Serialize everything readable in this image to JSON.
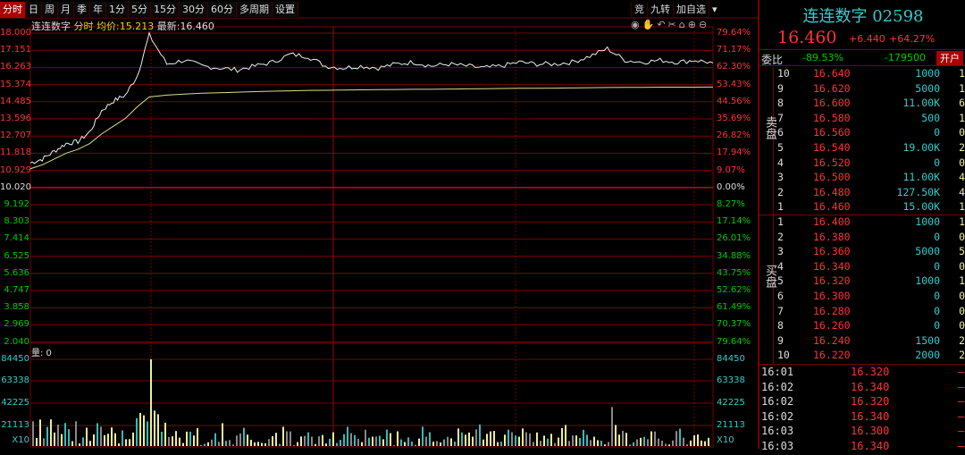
{
  "tabs": [
    "分时",
    "日",
    "周",
    "月",
    "季",
    "年",
    "1分",
    "5分",
    "15分",
    "30分",
    "60分",
    "多周期",
    "设置"
  ],
  "tools": [
    "竞",
    "九转",
    "加自选",
    "▾"
  ],
  "info": {
    "name": "连连数字",
    "mode": "分时",
    "avg_label": "均价:",
    "avg": "15.213",
    "last_label": "最新:",
    "last": "16.460"
  },
  "toolbar_icons": [
    "eye-icon",
    "hand-icon",
    "undo-icon",
    "scissors-icon",
    "lock-icon",
    "zoom-in-icon",
    "zoom-out-icon"
  ],
  "left_axis": [
    "18.000",
    "17.151",
    "16.263",
    "15.374",
    "14.485",
    "13.596",
    "12.707",
    "11.818",
    "10.929",
    "10.020",
    "9.192",
    "8.303",
    "7.414",
    "6.525",
    "5.636",
    "4.747",
    "3.858",
    "2.969",
    "2.040"
  ],
  "right_axis": [
    "79.64%",
    "71.17%",
    "62.30%",
    "53.43%",
    "44.56%",
    "35.69%",
    "26.82%",
    "17.94%",
    "9.07%",
    "0.00%",
    "8.27%",
    "17.14%",
    "26.01%",
    "34.88%",
    "43.75%",
    "52.62%",
    "61.49%",
    "70.37%",
    "79.64%"
  ],
  "volume_label": "量: 0",
  "volume_axis": [
    "84450",
    "63338",
    "42225",
    "21113",
    "X10"
  ],
  "chart_data": {
    "type": "line",
    "price": [
      11.3,
      11.5,
      11.9,
      12.3,
      12.4,
      12.9,
      14.0,
      14.5,
      14.8,
      15.8,
      17.9,
      16.4,
      16.6,
      16.3,
      16.2,
      16.1,
      16.3,
      16.5,
      16.9,
      16.8,
      16.3,
      16.2,
      16.3,
      16.2,
      16.4,
      16.5,
      16.3,
      16.4,
      16.3,
      16.2,
      16.3,
      16.5,
      16.4,
      16.4,
      16.5,
      16.8,
      17.2,
      16.6,
      16.5,
      16.6,
      16.5,
      16.6,
      16.46
    ],
    "avg": [
      11.0,
      11.2,
      11.5,
      11.8,
      12.0,
      12.3,
      12.8,
      13.2,
      13.6,
      14.2,
      14.7,
      14.8,
      14.85,
      14.9,
      14.92,
      14.95,
      14.98,
      15.0,
      15.02,
      15.04,
      15.05,
      15.06,
      15.07,
      15.08,
      15.09,
      15.1,
      15.1,
      15.11,
      15.12,
      15.13,
      15.14,
      15.15,
      15.15,
      15.16,
      15.17,
      15.18,
      15.19,
      15.2,
      15.2,
      15.21,
      15.21,
      15.21,
      15.213
    ],
    "ylim": [
      2.04,
      18.0
    ],
    "vol_max": 84450
  },
  "stock": {
    "title": "连连数字 02598",
    "price": "16.460",
    "change": "+6.440",
    "pct": "+64.27%"
  },
  "weibi": {
    "label": "委比",
    "pct": "-89.53%",
    "diff": "-179500",
    "button": "开户"
  },
  "sell_label": "卖盘",
  "buy_label": "买盘",
  "asks": [
    [
      "10",
      "16.640",
      "1000",
      "1"
    ],
    [
      "9",
      "16.620",
      "5000",
      "1"
    ],
    [
      "8",
      "16.600",
      "11.00K",
      "6"
    ],
    [
      "7",
      "16.580",
      "500",
      "1"
    ],
    [
      "6",
      "16.560",
      "0",
      "0"
    ],
    [
      "5",
      "16.540",
      "19.00K",
      "2"
    ],
    [
      "4",
      "16.520",
      "0",
      "0"
    ],
    [
      "3",
      "16.500",
      "11.00K",
      "4"
    ],
    [
      "2",
      "16.480",
      "127.50K",
      "4"
    ],
    [
      "1",
      "16.460",
      "15.00K",
      "1"
    ]
  ],
  "bids": [
    [
      "1",
      "16.400",
      "1000",
      "1"
    ],
    [
      "2",
      "16.380",
      "0",
      "0"
    ],
    [
      "3",
      "16.360",
      "5000",
      "5"
    ],
    [
      "4",
      "16.340",
      "0",
      "0"
    ],
    [
      "5",
      "16.320",
      "1000",
      "1"
    ],
    [
      "6",
      "16.300",
      "0",
      "0"
    ],
    [
      "7",
      "16.280",
      "0",
      "0"
    ],
    [
      "8",
      "16.260",
      "0",
      "0"
    ],
    [
      "9",
      "16.240",
      "1500",
      "2"
    ],
    [
      "10",
      "16.220",
      "2000",
      "2"
    ]
  ],
  "trades": [
    [
      "16:01",
      "16.320",
      "—"
    ],
    [
      "16:02",
      "16.340",
      "—"
    ],
    [
      "16:02",
      "16.320",
      "—"
    ],
    [
      "16:02",
      "16.340",
      "—"
    ],
    [
      "16:03",
      "16.300",
      "—"
    ],
    [
      "16:03",
      "16.340",
      "—"
    ]
  ],
  "colors": {
    "up": "#ff3333",
    "down": "#00cc00",
    "cyan": "#33cccc",
    "grid": "#7a0000"
  }
}
